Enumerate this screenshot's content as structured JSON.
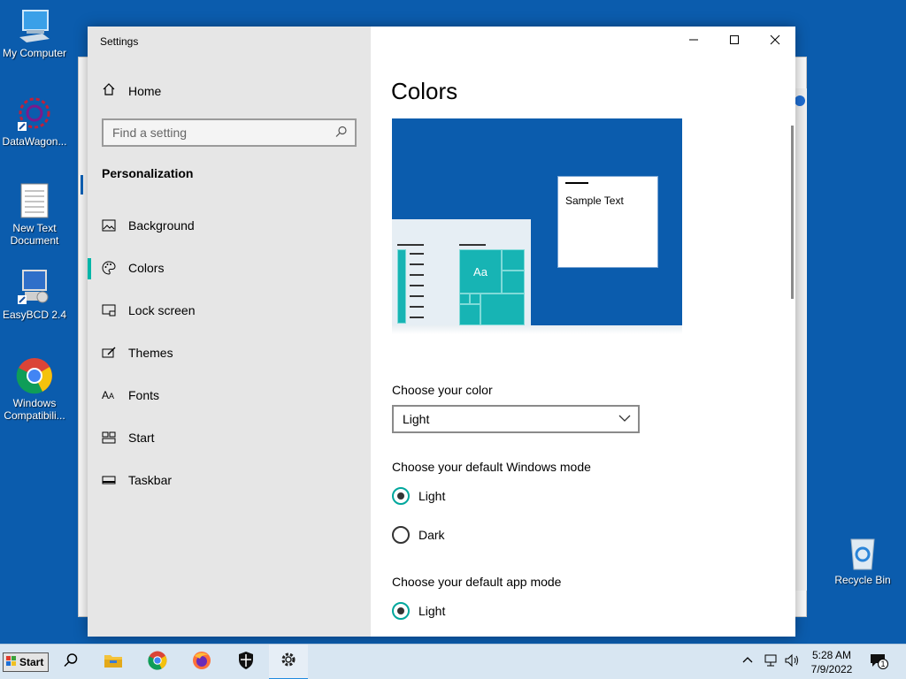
{
  "desktop": {
    "icons": [
      {
        "label": "My Computer"
      },
      {
        "label": "DataWagon..."
      },
      {
        "label": "New Text Document"
      },
      {
        "label": "EasyBCD 2.4"
      },
      {
        "label": "Windows Compatibili..."
      },
      {
        "label": "Recycle Bin"
      }
    ]
  },
  "window": {
    "title": "Settings",
    "controls": {
      "minimize": "—",
      "maximize": "☐",
      "close": "✕"
    }
  },
  "sidebar": {
    "home": "Home",
    "search_placeholder": "Find a setting",
    "section": "Personalization",
    "items": [
      {
        "label": "Background",
        "icon": "image-icon"
      },
      {
        "label": "Colors",
        "icon": "palette-icon",
        "active": true
      },
      {
        "label": "Lock screen",
        "icon": "lock-screen-icon"
      },
      {
        "label": "Themes",
        "icon": "brush-icon"
      },
      {
        "label": "Fonts",
        "icon": "font-icon"
      },
      {
        "label": "Start",
        "icon": "start-tiles-icon"
      },
      {
        "label": "Taskbar",
        "icon": "taskbar-icon"
      }
    ]
  },
  "main": {
    "title": "Colors",
    "preview": {
      "sample_text": "Sample Text",
      "tile_text": "Aa"
    },
    "choose_color_label": "Choose your color",
    "choose_color_value": "Light",
    "windows_mode_label": "Choose your default Windows mode",
    "windows_mode_options": [
      "Light",
      "Dark"
    ],
    "windows_mode_selected": "Light",
    "app_mode_label": "Choose your default app mode",
    "app_mode_options": [
      "Light"
    ],
    "app_mode_selected": "Light"
  },
  "taskbar": {
    "start_label": "Start",
    "time": "5:28 AM",
    "date": "7/9/2022",
    "notification_count": "1"
  },
  "colors": {
    "accent": "#0b5cad",
    "teal": "#00b5a8",
    "sidebar_bg": "#e6e6e6"
  }
}
